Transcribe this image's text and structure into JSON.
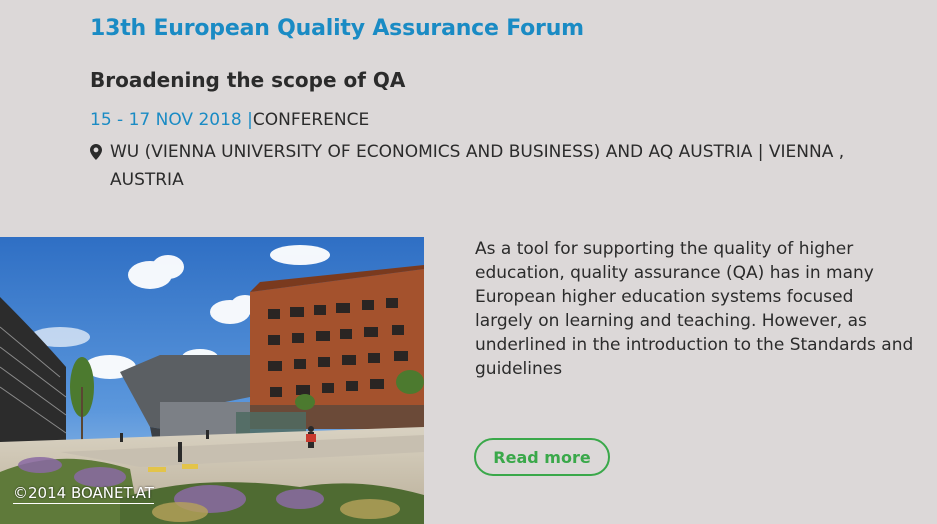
{
  "event": {
    "title": "13th European Quality Assurance Forum",
    "subtitle": "Broadening the scope of QA",
    "date": "15 - 17 NOV 2018",
    "separator": "|",
    "type": "CONFERENCE",
    "location_icon": "map-pin-icon",
    "location": "WU (VIENNA UNIVERSITY OF ECONOMICS AND BUSINESS) AND AQ AUSTRIA | VIENNA , AUSTRIA"
  },
  "photo": {
    "credit": "©2014 BOANET.AT"
  },
  "description": "As a tool for supporting the quality of higher education, quality assurance (QA) has in many European higher education systems focused largely on learning and teaching. However, as underlined in the introduction to the Standards and guidelines",
  "read_more": {
    "label": "Read more"
  },
  "colors": {
    "background": "#dcd8d8",
    "accent_blue": "#1a8bc4",
    "button_green": "#3aa84a",
    "text": "#2b2b2b"
  }
}
